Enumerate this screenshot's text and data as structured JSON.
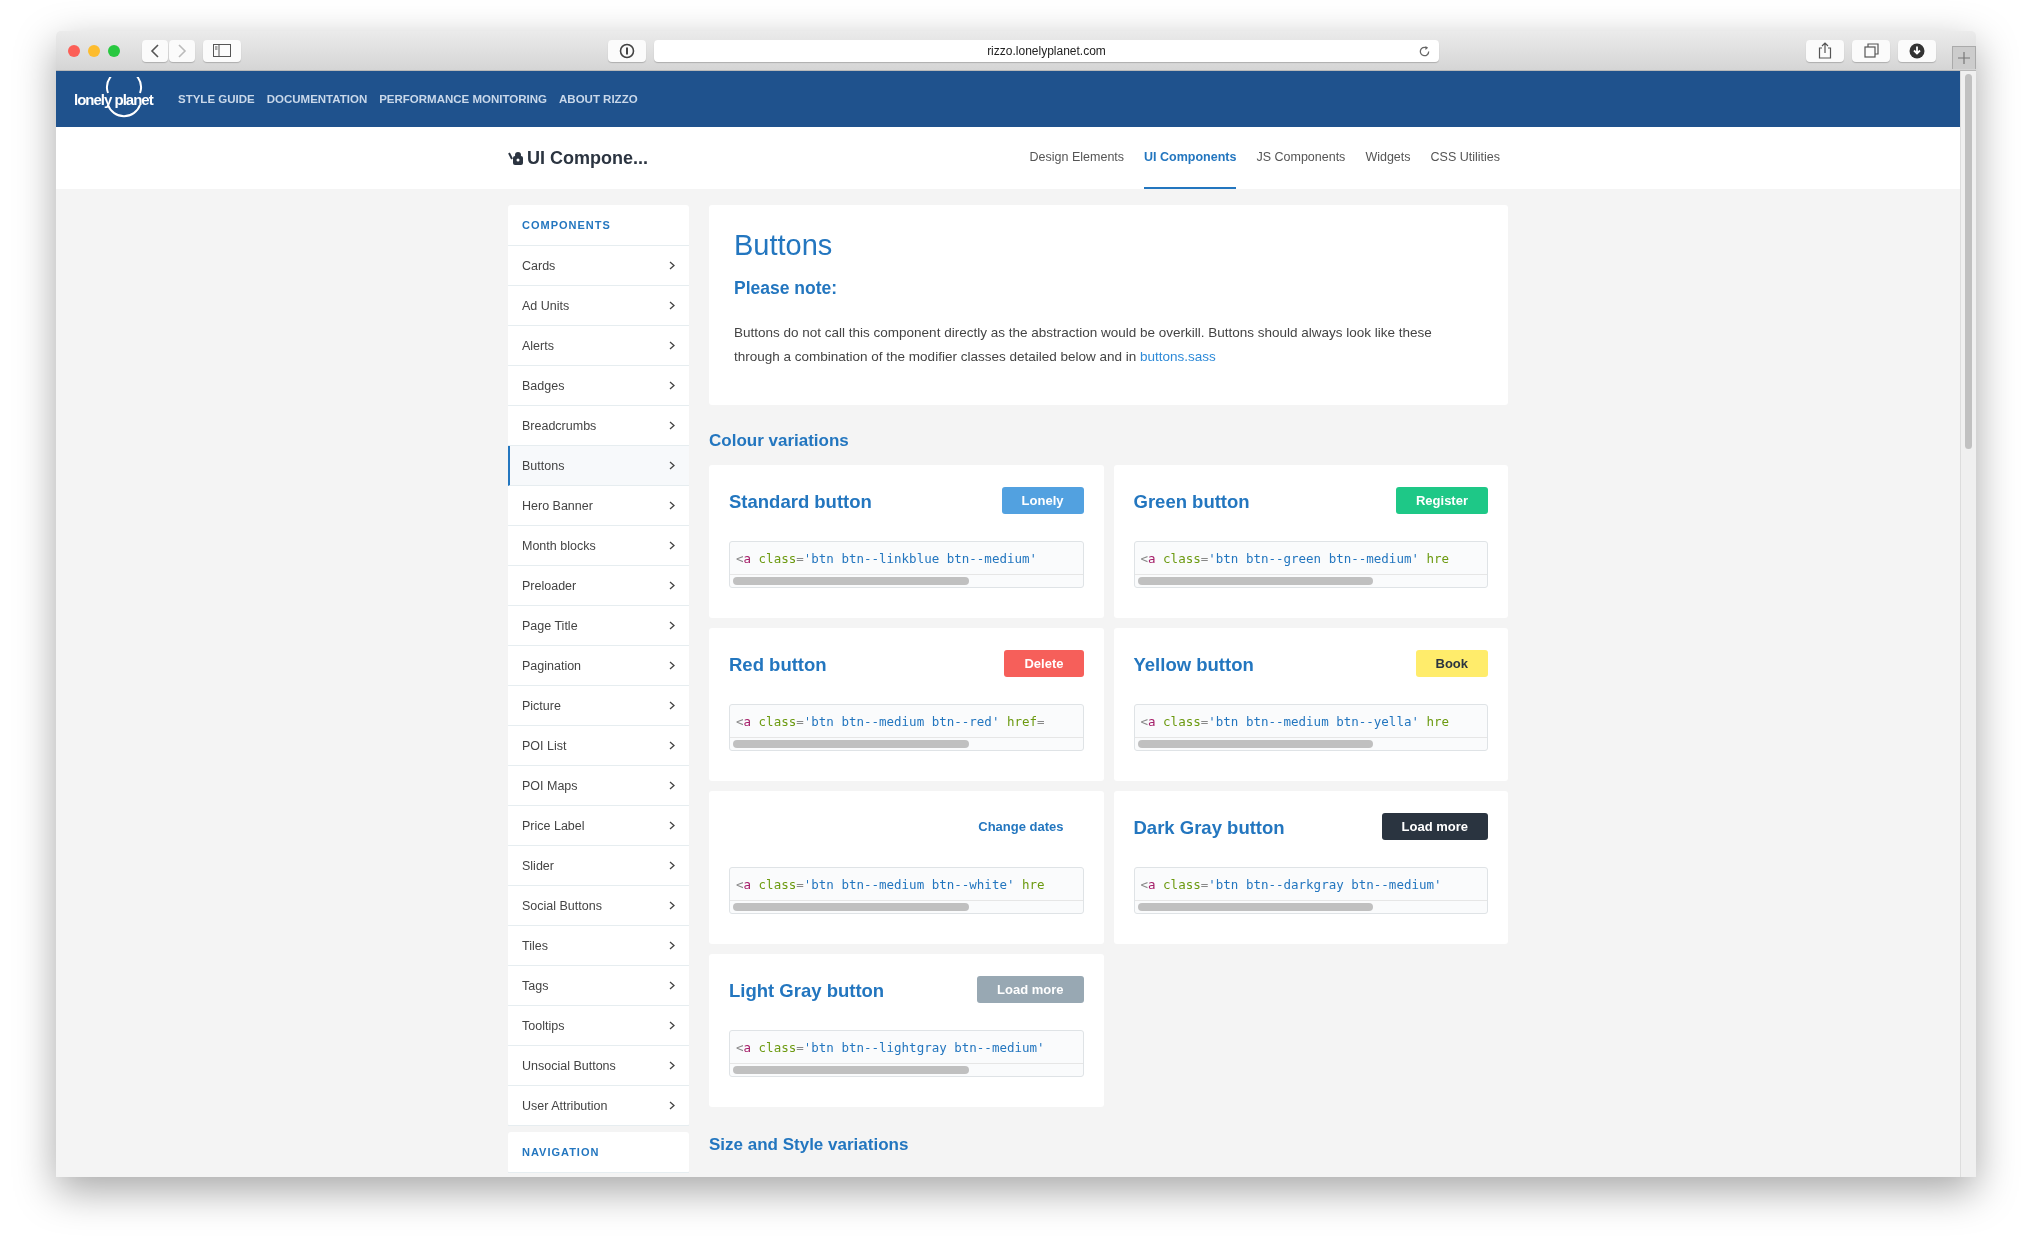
{
  "browser": {
    "url": "rizzo.lonelyplanet.com"
  },
  "site_nav": {
    "logo": "lonely planet",
    "links": [
      "STYLE GUIDE",
      "DOCUMENTATION",
      "PERFORMANCE MONITORING",
      "ABOUT RIZZO"
    ]
  },
  "page_header": {
    "title": "UI Compone...",
    "tabs": [
      {
        "label": "Design Elements",
        "selected": false
      },
      {
        "label": "UI Components",
        "selected": true
      },
      {
        "label": "JS Components",
        "selected": false
      },
      {
        "label": "Widgets",
        "selected": false
      },
      {
        "label": "CSS Utilities",
        "selected": false
      }
    ]
  },
  "sidebar": {
    "heading": "COMPONENTS",
    "items": [
      {
        "label": "Cards",
        "selected": false
      },
      {
        "label": "Ad Units",
        "selected": false
      },
      {
        "label": "Alerts",
        "selected": false
      },
      {
        "label": "Badges",
        "selected": false
      },
      {
        "label": "Breadcrumbs",
        "selected": false
      },
      {
        "label": "Buttons",
        "selected": true
      },
      {
        "label": "Hero Banner",
        "selected": false
      },
      {
        "label": "Month blocks",
        "selected": false
      },
      {
        "label": "Preloader",
        "selected": false
      },
      {
        "label": "Page Title",
        "selected": false
      },
      {
        "label": "Pagination",
        "selected": false
      },
      {
        "label": "Picture",
        "selected": false
      },
      {
        "label": "POI List",
        "selected": false
      },
      {
        "label": "POI Maps",
        "selected": false
      },
      {
        "label": "Price Label",
        "selected": false
      },
      {
        "label": "Slider",
        "selected": false
      },
      {
        "label": "Social Buttons",
        "selected": false
      },
      {
        "label": "Tiles",
        "selected": false
      },
      {
        "label": "Tags",
        "selected": false
      },
      {
        "label": "Tooltips",
        "selected": false
      },
      {
        "label": "Unsocial Buttons",
        "selected": false
      },
      {
        "label": "User Attribution",
        "selected": false
      }
    ],
    "next_heading": "NAVIGATION"
  },
  "intro": {
    "title": "Buttons",
    "subtitle": "Please note:",
    "text": "Buttons do not call this component directly as the abstraction would be overkill. Buttons should always look like these through a combination of the modifier classes detailed below and in",
    "link": "buttons.sass"
  },
  "section_title": "Colour variations",
  "cards": [
    {
      "title": "Standard button",
      "button": {
        "label": "Lonely",
        "kind": "linkblue"
      },
      "code": [
        {
          "kind": "punct",
          "text": "<"
        },
        {
          "kind": "tag",
          "text": "a"
        },
        {
          "kind": "attr",
          "text": " class"
        },
        {
          "kind": "punct",
          "text": "="
        },
        {
          "kind": "string",
          "text": "'btn btn--linkblue btn--medium'"
        }
      ]
    },
    {
      "title": "Green button",
      "button": {
        "label": "Register",
        "kind": "green"
      },
      "code": [
        {
          "kind": "punct",
          "text": "<"
        },
        {
          "kind": "tag",
          "text": "a"
        },
        {
          "kind": "attr",
          "text": " class"
        },
        {
          "kind": "punct",
          "text": "="
        },
        {
          "kind": "string",
          "text": "'btn btn--green btn--medium'"
        },
        {
          "kind": "attr",
          "text": " hre"
        }
      ]
    },
    {
      "title": "Red button",
      "button": {
        "label": "Delete",
        "kind": "red"
      },
      "code": [
        {
          "kind": "punct",
          "text": "<"
        },
        {
          "kind": "tag",
          "text": "a"
        },
        {
          "kind": "attr",
          "text": " class"
        },
        {
          "kind": "punct",
          "text": "="
        },
        {
          "kind": "string",
          "text": "'btn btn--medium btn--red'"
        },
        {
          "kind": "attr",
          "text": " href"
        },
        {
          "kind": "punct",
          "text": "="
        }
      ]
    },
    {
      "title": "Yellow button",
      "button": {
        "label": "Book",
        "kind": "yellow"
      },
      "code": [
        {
          "kind": "punct",
          "text": "<"
        },
        {
          "kind": "tag",
          "text": "a"
        },
        {
          "kind": "attr",
          "text": " class"
        },
        {
          "kind": "punct",
          "text": "="
        },
        {
          "kind": "string",
          "text": "'btn btn--medium btn--yella'"
        },
        {
          "kind": "attr",
          "text": " hre"
        }
      ]
    },
    {
      "button": {
        "label": "Change dates",
        "kind": "white"
      },
      "code": [
        {
          "kind": "punct",
          "text": "<"
        },
        {
          "kind": "tag",
          "text": "a"
        },
        {
          "kind": "attr",
          "text": " class"
        },
        {
          "kind": "punct",
          "text": "="
        },
        {
          "kind": "string",
          "text": "'btn btn--medium btn--white'"
        },
        {
          "kind": "attr",
          "text": " hre"
        }
      ]
    },
    {
      "title": "Dark Gray button",
      "button": {
        "label": "Load more",
        "kind": "darkgray"
      },
      "code": [
        {
          "kind": "punct",
          "text": "<"
        },
        {
          "kind": "tag",
          "text": "a"
        },
        {
          "kind": "attr",
          "text": " class"
        },
        {
          "kind": "punct",
          "text": "="
        },
        {
          "kind": "string",
          "text": "'btn btn--darkgray btn--medium'"
        }
      ]
    },
    {
      "title": "Light Gray button",
      "button": {
        "label": "Load more",
        "kind": "lightgray"
      },
      "code": [
        {
          "kind": "punct",
          "text": "<"
        },
        {
          "kind": "tag",
          "text": "a"
        },
        {
          "kind": "attr",
          "text": " class"
        },
        {
          "kind": "punct",
          "text": "="
        },
        {
          "kind": "string",
          "text": "'btn btn--lightgray btn--medium'"
        }
      ]
    }
  ],
  "next_section_title": "Size and Style variations"
}
